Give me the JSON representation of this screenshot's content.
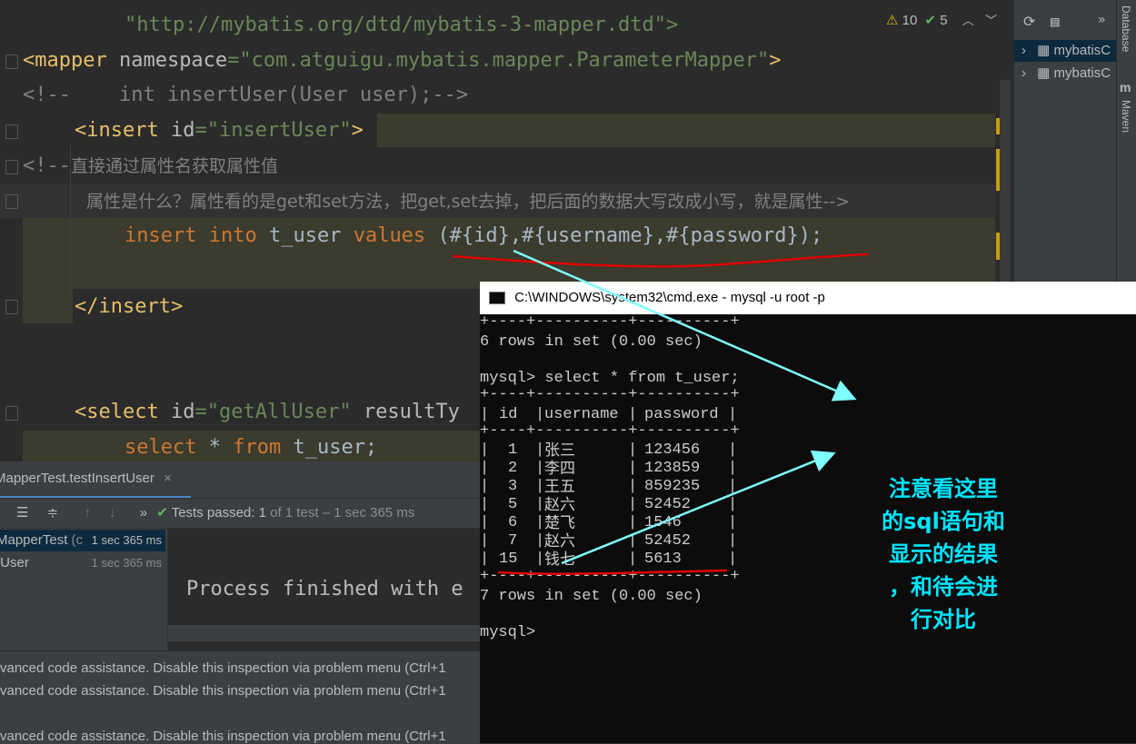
{
  "editor": {
    "lines": {
      "l1": "\"http://mybatis.org/dtd/mybatis-3-mapper.dtd\">",
      "l2_tag": "<mapper",
      "l2_attr": " namespace",
      "l2_eq": "=",
      "l2_val": "\"com.atguigu.mybatis.mapper.ParameterMapper\"",
      "l2_end": ">",
      "l3": "<!--    int insertUser(User user);-->",
      "l4_tag": "<insert",
      "l4_attr": " id",
      "l4_eq": "=",
      "l4_val": "\"insertUser\"",
      "l4_end": ">",
      "l5_start": "<!--",
      "l5_text": "直接通过属性名获取属性值",
      "l6_text": "属性是什么？属性看的是get和set方法，把get,set去掉，把后面的数据大写改成小写，就是属性-->",
      "l7_kw1": "insert",
      "l7_kw2": "into",
      "l7_table": "t_user",
      "l7_kw3": "values",
      "l7_vals": "(#{id},#{username},#{password});",
      "l9": "</insert>",
      "l12_tag": "<select",
      "l12_attr": " id",
      "l12_eq": "=",
      "l12_val": "\"getAllUser\"",
      "l12_rest": " resultTy",
      "l13_kw1": "select",
      "l13_star": " * ",
      "l13_kw2": "from",
      "l13_table": " t_user;"
    },
    "inspection": {
      "warnings": "10",
      "weak": "5"
    }
  },
  "right_panel": {
    "items": [
      "mybatisC",
      "mybatisC"
    ],
    "tabs": [
      "Database",
      "Maven"
    ]
  },
  "run_panel": {
    "tab_label": "MapperTest.testInsertUser",
    "status": "Tests passed: 1",
    "status_detail": "of 1 test – 1 sec 365 ms",
    "tree": [
      {
        "label": "MapperTest",
        "suffix": "(c",
        "time": "1 sec 365 ms"
      },
      {
        "label": "tUser",
        "time": "1 sec 365 ms"
      }
    ],
    "console": "Process finished with e",
    "messages": [
      "vanced code assistance. Disable this inspection via problem menu (Ctrl+1",
      "vanced code assistance. Disable this inspection via problem menu (Ctrl+1",
      "vanced code assistance. Disable this inspection via problem menu (Ctrl+1"
    ]
  },
  "cmd": {
    "title": "C:\\WINDOWS\\system32\\cmd.exe - mysql  -u root -p",
    "border": "+----+----------+----------+",
    "prev_result": "6 rows in set (0.00 sec)",
    "query": "mysql> select * from t_user;",
    "headers": [
      "id",
      "username",
      "password"
    ],
    "rows": [
      [
        "1",
        "张三",
        "123456"
      ],
      [
        "2",
        "李四",
        "123859"
      ],
      [
        "3",
        "王五",
        "859235"
      ],
      [
        "5",
        "赵六",
        "52452"
      ],
      [
        "6",
        "楚飞",
        "1546"
      ],
      [
        "7",
        "赵六",
        "52452"
      ],
      [
        "15",
        "钱七",
        "5613"
      ]
    ],
    "result": "7 rows in set (0.00 sec)",
    "prompt": "mysql>"
  },
  "annotation": {
    "lines": [
      "注意看这里",
      "的sql语句和",
      "显示的结果",
      "，和待会进",
      "行对比"
    ]
  },
  "colors": {
    "annotation": "#00e5ff",
    "underline": "#e00000",
    "arrow": "#7fffff"
  }
}
